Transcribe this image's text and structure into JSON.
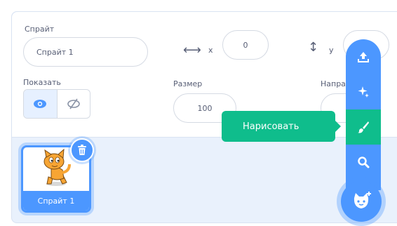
{
  "sprite_info": {
    "sprite_label": "Спрайт",
    "sprite_name": "Спрайт 1",
    "x_label": "x",
    "x_value": "0",
    "y_label": "y",
    "show_label": "Показать",
    "size_label": "Размер",
    "size_value": "100",
    "direction_label": "Напра"
  },
  "sprites": [
    {
      "name": "Спрайт 1",
      "selected": true
    }
  ],
  "tooltip": {
    "text": "Нарисовать"
  },
  "flyout_menu": {
    "items": [
      {
        "icon": "upload-icon"
      },
      {
        "icon": "surprise-icon"
      },
      {
        "icon": "paintbrush-icon",
        "active": true
      },
      {
        "icon": "search-icon"
      }
    ],
    "main_icon": "cat-plus-icon"
  },
  "colors": {
    "accent": "#4c97ff",
    "paint_green": "#0fbd8c",
    "panel_bg": "#e9f1fc",
    "text": "#575e75"
  }
}
